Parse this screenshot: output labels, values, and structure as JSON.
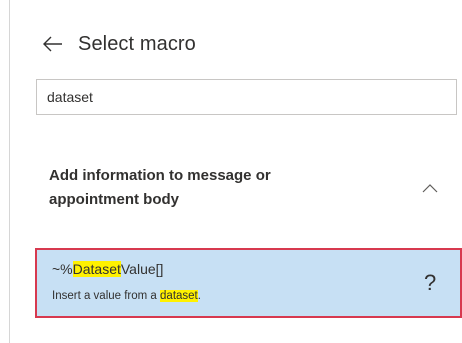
{
  "header": {
    "back_icon": "arrow-left-icon",
    "title": "Select macro"
  },
  "search": {
    "value": "dataset",
    "placeholder": ""
  },
  "group": {
    "title": "Add information to message or appointment body",
    "chevron_icon": "chevron-up-icon",
    "expanded": true
  },
  "macro": {
    "name_prefix": "~%",
    "name_match": "Dataset",
    "name_suffix": "Value[]",
    "desc_prefix": "Insert a value from a ",
    "desc_match": "dataset",
    "desc_suffix": ".",
    "help_label": "?",
    "selected": true
  },
  "colors": {
    "selection_bg": "#c7e0f4",
    "selection_border": "#d7394f",
    "highlight": "#fff100"
  }
}
